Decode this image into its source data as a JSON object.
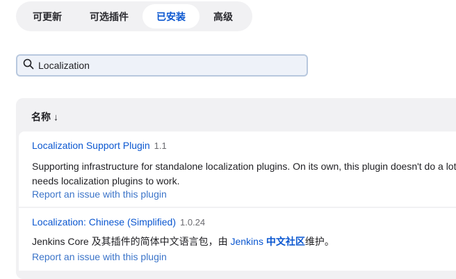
{
  "tabs": [
    {
      "label": "可更新"
    },
    {
      "label": "可选插件"
    },
    {
      "label": "已安装"
    },
    {
      "label": "高级"
    }
  ],
  "search": {
    "value": "Localization",
    "icon": "search-icon"
  },
  "table": {
    "header": {
      "name_label": "名称",
      "sort_arrow": "↓"
    },
    "plugins": [
      {
        "name": "Localization Support Plugin",
        "version": "1.1",
        "description": "Supporting infrastructure for standalone localization plugins. On its own, this plugin doesn't do a lot, it needs localization plugins to work.",
        "report": "Report an issue with this plugin"
      },
      {
        "name": "Localization: Chinese (Simplified)",
        "version": "1.0.24",
        "description_prefix": "Jenkins Core 及其插件的简体中文语言包，由 ",
        "description_link": "Jenkins",
        "description_bold": "中文社区",
        "description_suffix": "维护。",
        "report": "Report an issue with this plugin"
      }
    ]
  },
  "colors": {
    "accent": "#0b57d0",
    "tab_bg": "#f1f1f3",
    "search_border": "#b8c8de"
  }
}
